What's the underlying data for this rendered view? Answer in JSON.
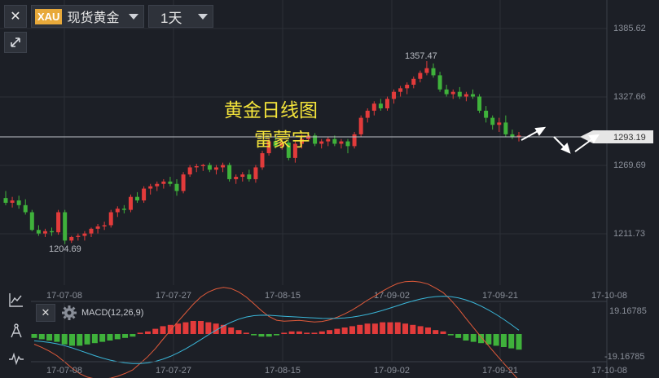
{
  "toolbar": {
    "close_label": "✕",
    "symbol_badge": "XAU",
    "symbol_name": "现货黄金",
    "period": "1天",
    "expand_icon": "expand-icon"
  },
  "overlay": {
    "title": "黄金日线图",
    "author": "雷蒙宇"
  },
  "chart_data": {
    "type": "candlestick",
    "price_axis": [
      "1385.62",
      "1327.66",
      "1269.69",
      "1211.73"
    ],
    "current_price": "1293.19",
    "high_label": "1357.47",
    "low_label": "1204.69",
    "dates_main": [
      "17-07-08",
      "17-07-27",
      "17-08-15",
      "17-09-02",
      "17-09-21",
      "17-10-08"
    ],
    "dates_macd": [
      "17-07-08",
      "17-07-27",
      "17-08-15",
      "17-09-02",
      "17-09-21",
      "17-10-08"
    ],
    "macd": {
      "label": "MACD(12,26,9)",
      "top": "19.16785",
      "bottom": "-19.16785"
    },
    "colors": {
      "up": "#e23b3b",
      "down": "#3fb23b",
      "dif": "#e05a3a",
      "dea": "#3ab6d8"
    },
    "candles": [
      [
        1242,
        1248,
        1236,
        1238
      ],
      [
        1238,
        1243,
        1234,
        1240
      ],
      [
        1240,
        1244,
        1233,
        1236
      ],
      [
        1236,
        1241,
        1228,
        1230
      ],
      [
        1230,
        1232,
        1214,
        1215
      ],
      [
        1215,
        1219,
        1210,
        1212
      ],
      [
        1212,
        1216,
        1209,
        1214
      ],
      [
        1214,
        1217,
        1210,
        1213
      ],
      [
        1213,
        1232,
        1211,
        1230
      ],
      [
        1230,
        1232,
        1203,
        1206
      ],
      [
        1206,
        1210,
        1204,
        1209
      ],
      [
        1209,
        1212,
        1206,
        1210
      ],
      [
        1210,
        1214,
        1206,
        1212
      ],
      [
        1212,
        1217,
        1209,
        1216
      ],
      [
        1216,
        1220,
        1212,
        1218
      ],
      [
        1218,
        1222,
        1215,
        1219
      ],
      [
        1219,
        1232,
        1217,
        1230
      ],
      [
        1230,
        1235,
        1226,
        1233
      ],
      [
        1233,
        1236,
        1229,
        1232
      ],
      [
        1232,
        1245,
        1230,
        1243
      ],
      [
        1243,
        1247,
        1238,
        1240
      ],
      [
        1240,
        1252,
        1238,
        1250
      ],
      [
        1250,
        1254,
        1245,
        1252
      ],
      [
        1252,
        1256,
        1248,
        1254
      ],
      [
        1254,
        1258,
        1250,
        1256
      ],
      [
        1256,
        1260,
        1252,
        1254
      ],
      [
        1254,
        1258,
        1244,
        1248
      ],
      [
        1248,
        1264,
        1246,
        1262
      ],
      [
        1262,
        1270,
        1260,
        1268
      ],
      [
        1268,
        1271,
        1264,
        1269
      ],
      [
        1269,
        1271,
        1265,
        1270
      ],
      [
        1270,
        1272,
        1264,
        1266
      ],
      [
        1266,
        1270,
        1262,
        1268
      ],
      [
        1268,
        1272,
        1264,
        1270
      ],
      [
        1270,
        1272,
        1256,
        1258
      ],
      [
        1258,
        1262,
        1254,
        1260
      ],
      [
        1260,
        1264,
        1256,
        1262
      ],
      [
        1262,
        1266,
        1256,
        1258
      ],
      [
        1258,
        1270,
        1255,
        1268
      ],
      [
        1268,
        1282,
        1266,
        1280
      ],
      [
        1280,
        1292,
        1278,
        1290
      ],
      [
        1290,
        1294,
        1284,
        1286
      ],
      [
        1286,
        1292,
        1283,
        1289
      ],
      [
        1289,
        1291,
        1274,
        1276
      ],
      [
        1276,
        1290,
        1272,
        1288
      ],
      [
        1288,
        1296,
        1284,
        1292
      ],
      [
        1292,
        1298,
        1290,
        1295
      ],
      [
        1295,
        1297,
        1286,
        1288
      ],
      [
        1288,
        1292,
        1284,
        1290
      ],
      [
        1290,
        1294,
        1286,
        1292
      ],
      [
        1292,
        1295,
        1286,
        1288
      ],
      [
        1288,
        1292,
        1284,
        1290
      ],
      [
        1290,
        1292,
        1280,
        1286
      ],
      [
        1286,
        1298,
        1284,
        1296
      ],
      [
        1296,
        1312,
        1294,
        1310
      ],
      [
        1310,
        1318,
        1306,
        1316
      ],
      [
        1316,
        1324,
        1312,
        1322
      ],
      [
        1322,
        1326,
        1316,
        1318
      ],
      [
        1318,
        1328,
        1316,
        1326
      ],
      [
        1326,
        1334,
        1322,
        1332
      ],
      [
        1332,
        1337,
        1328,
        1335
      ],
      [
        1335,
        1340,
        1330,
        1338
      ],
      [
        1338,
        1345,
        1335,
        1343
      ],
      [
        1343,
        1350,
        1340,
        1348
      ],
      [
        1348,
        1358,
        1346,
        1352
      ],
      [
        1352,
        1356,
        1344,
        1346
      ],
      [
        1346,
        1349,
        1332,
        1334
      ],
      [
        1334,
        1338,
        1328,
        1330
      ],
      [
        1330,
        1334,
        1326,
        1332
      ],
      [
        1332,
        1336,
        1326,
        1328
      ],
      [
        1328,
        1332,
        1324,
        1330
      ],
      [
        1330,
        1334,
        1326,
        1328
      ],
      [
        1328,
        1330,
        1314,
        1316
      ],
      [
        1316,
        1320,
        1306,
        1310
      ],
      [
        1310,
        1312,
        1300,
        1304
      ],
      [
        1304,
        1310,
        1298,
        1306
      ],
      [
        1306,
        1312,
        1294,
        1296
      ],
      [
        1296,
        1300,
        1292,
        1294
      ],
      [
        1294,
        1298,
        1290,
        1295
      ]
    ],
    "macd_hist": [
      -3,
      -4,
      -5,
      -6,
      -8,
      -9,
      -9,
      -8,
      -7,
      -6,
      -5,
      -4,
      -3,
      -2,
      1,
      2,
      4,
      6,
      7,
      8,
      9,
      10,
      10,
      9,
      8,
      7,
      5,
      3,
      1,
      -1,
      -2,
      -2,
      -1,
      1,
      2,
      2,
      1,
      1,
      2,
      3,
      4,
      5,
      6,
      7,
      8,
      8,
      9,
      9,
      9,
      8,
      7,
      6,
      5,
      3,
      2,
      -1,
      -3,
      -5,
      -6,
      -7,
      -8,
      -9,
      -10,
      -11,
      -12
    ]
  }
}
